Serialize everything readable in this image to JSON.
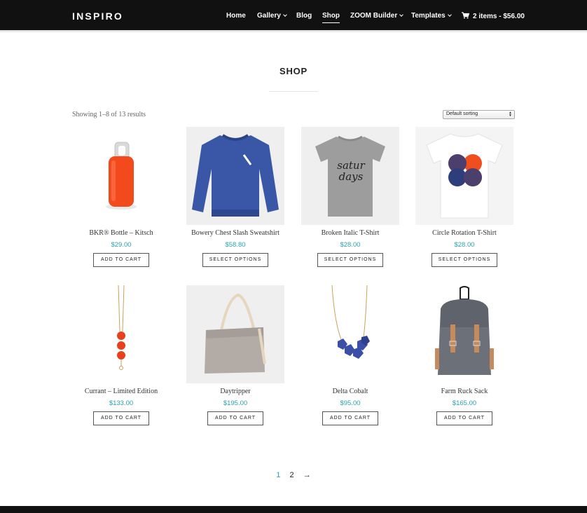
{
  "header": {
    "logo": "INSPIRO",
    "nav": [
      {
        "label": "Home"
      },
      {
        "label": "Gallery"
      },
      {
        "label": "Blog"
      },
      {
        "label": "Shop"
      },
      {
        "label": "ZOOM Builder"
      },
      {
        "label": "Templates"
      }
    ],
    "cart_label": "2 items - $56.00"
  },
  "page": {
    "title": "SHOP",
    "result_count": "Showing 1–8 of 13 results",
    "sort_selected": "Default sorting"
  },
  "products": [
    {
      "name": "BKR® Bottle – Kitsch",
      "price": "$29.00",
      "button": "ADD TO CART"
    },
    {
      "name": "Bowery Chest Slash Sweatshirt",
      "price": "$58.80",
      "button": "SELECT OPTIONS"
    },
    {
      "name": "Broken Italic T-Shirt",
      "price": "$28.00",
      "button": "SELECT OPTIONS"
    },
    {
      "name": "Circle Rotation T-Shirt",
      "price": "$28.00",
      "button": "SELECT OPTIONS"
    },
    {
      "name": "Currant – Limited Edition",
      "price": "$133.00",
      "button": "ADD TO CART"
    },
    {
      "name": "Daytripper",
      "price": "$195.00",
      "button": "ADD TO CART"
    },
    {
      "name": "Delta Cobalt",
      "price": "$95.00",
      "button": "ADD TO CART"
    },
    {
      "name": "Farm Ruck Sack",
      "price": "$165.00",
      "button": "ADD TO CART"
    }
  ],
  "tshirt_print": [
    "satur",
    "days"
  ],
  "pagination": {
    "pages": [
      "1",
      "2"
    ],
    "next": "→"
  },
  "colors": {
    "accent": "#2aa3a8",
    "header_bg": "#111111"
  }
}
